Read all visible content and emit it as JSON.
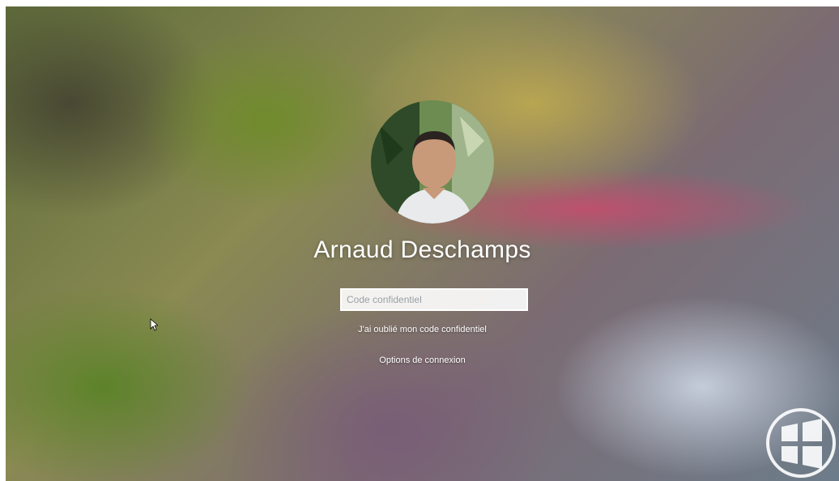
{
  "user": {
    "name": "Arnaud Deschamps"
  },
  "pin_field": {
    "placeholder": "Code confidentiel",
    "value": ""
  },
  "links": {
    "forgot_pin": "J'ai oublié mon code confidentiel",
    "sign_in_options": "Options de connexion"
  },
  "icons": {
    "avatar": "user-photo",
    "cursor": "mouse-pointer-icon",
    "logo": "windows-logo-icon"
  }
}
